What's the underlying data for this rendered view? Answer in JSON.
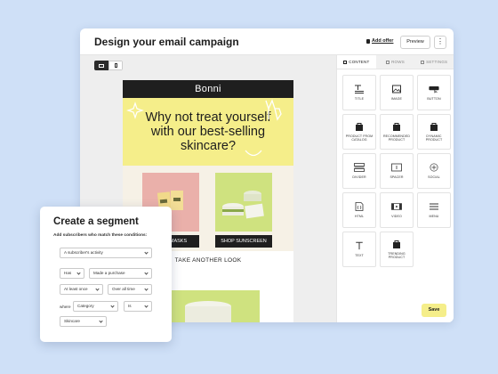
{
  "editor": {
    "title": "Design your email campaign",
    "add_offer": "Add offer",
    "preview": "Preview",
    "more": "⋮",
    "save": "Save"
  },
  "email": {
    "brand": "Bonni",
    "hero_text": "Why not treat yourself with our best-selling skincare?",
    "buttons": [
      "SHOP MASKS",
      "SHOP SUNSCREEN"
    ],
    "section_text": "TAKE ANOTHER LOOK"
  },
  "panel": {
    "tabs": [
      "CONTENT",
      "ROWS",
      "SETTINGS"
    ],
    "blocks": [
      {
        "label": "TITLE",
        "icon": "title-icon"
      },
      {
        "label": "IMAGE",
        "icon": "image-icon"
      },
      {
        "label": "BUTTON",
        "icon": "button-icon"
      },
      {
        "label": "PRODUCT FROM CATALOG",
        "icon": "bag-icon"
      },
      {
        "label": "RECOMMENDED PRODUCT",
        "icon": "bag-icon"
      },
      {
        "label": "DYNAMIC PRODUCT",
        "icon": "bag-icon"
      },
      {
        "label": "DIVIDER",
        "icon": "divider-icon"
      },
      {
        "label": "SPACER",
        "icon": "spacer-icon"
      },
      {
        "label": "SOCIAL",
        "icon": "social-icon"
      },
      {
        "label": "HTML",
        "icon": "html-icon"
      },
      {
        "label": "VIDEO",
        "icon": "video-icon"
      },
      {
        "label": "MENU",
        "icon": "menu-icon"
      },
      {
        "label": "TEXT",
        "icon": "text-icon"
      },
      {
        "label": "TRENDING PRODUCT",
        "icon": "bag-icon"
      }
    ]
  },
  "segment": {
    "title": "Create a segment",
    "subtitle": "Add subscribers who match these conditions:",
    "activity_select": "A subscriber's activity",
    "has_select": "Has",
    "purchase_select": "Made a purchase",
    "count_select": "At least once",
    "time_select": "Over all time",
    "where_label": "where",
    "category_select": "Category",
    "is_select": "Is",
    "value_select": "Skincare"
  },
  "colors": {
    "accent_yellow": "#f5ee8a",
    "product_green": "#cfe27f",
    "product_pink": "#eab0aa",
    "dark": "#1f1f1f"
  }
}
